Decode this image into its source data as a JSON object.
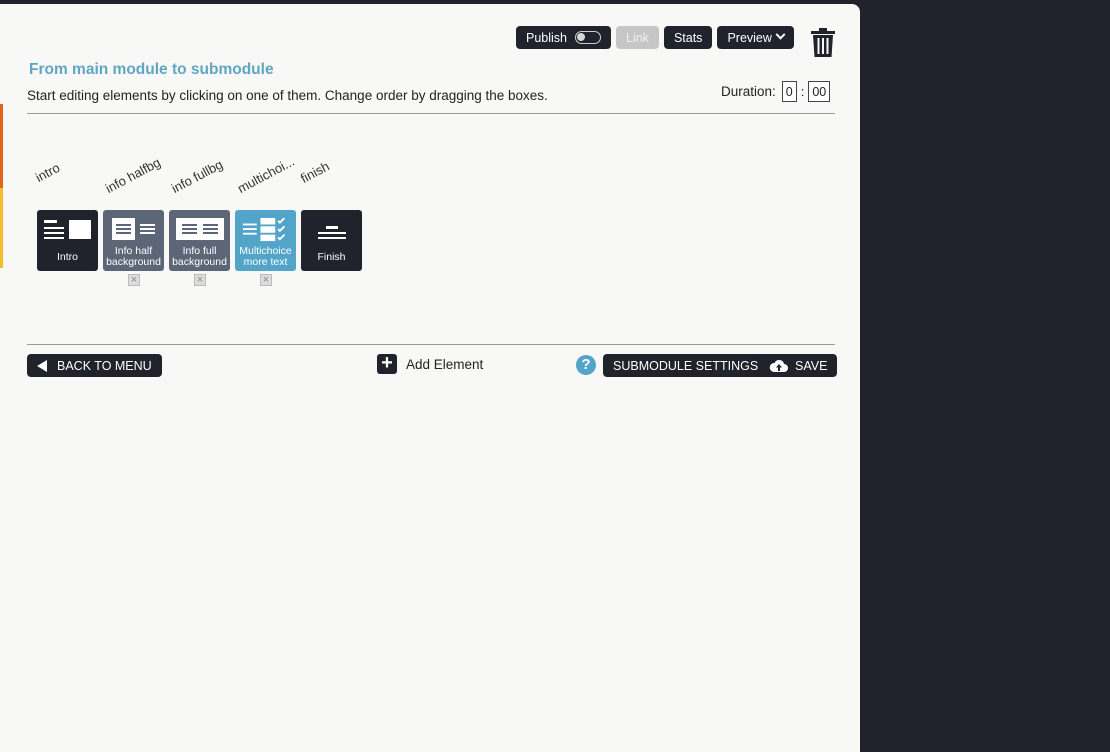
{
  "header": {
    "title": "From main module to submodule",
    "subtitle": "Start editing elements by clicking on one of them. Change order by dragging the boxes."
  },
  "toolbar": {
    "publish_label": "Publish",
    "publish_on": false,
    "link_label": "Link",
    "stats_label": "Stats",
    "preview_label": "Preview"
  },
  "duration": {
    "label": "Duration:",
    "minutes": "0",
    "separator": ":",
    "seconds": "00"
  },
  "elements": [
    {
      "label": "intro",
      "box_text": "Intro",
      "style": "dark",
      "deletable": false
    },
    {
      "label": "info halfbg",
      "box_text": "Info half background",
      "style": "gray",
      "deletable": true
    },
    {
      "label": "info fullbg",
      "box_text": "Info full background",
      "style": "gray",
      "deletable": true
    },
    {
      "label": "multichoi...",
      "box_text": "Multichoice more text",
      "style": "blue",
      "deletable": true
    },
    {
      "label": "finish",
      "box_text": "Finish",
      "style": "dark",
      "deletable": false
    }
  ],
  "footer": {
    "back_label": "BACK TO MENU",
    "add_label": "Add Element",
    "help_glyph": "?",
    "settings_label": "SUBMODULE SETTINGS",
    "save_label": "SAVE"
  },
  "colors": {
    "accent": "#52a5c8",
    "dark": "#20232b",
    "title": "#5fa6c2",
    "strip_orange": "#e0661a",
    "strip_yellow": "#f3bd2c"
  },
  "icons": [
    "toggle-icon",
    "chevron-down-icon",
    "trash-icon",
    "intro-layout-icon",
    "info-half-layout-icon",
    "info-full-layout-icon",
    "multichoice-layout-icon",
    "finish-layout-icon",
    "close-icon",
    "back-arrow-icon",
    "plus-icon",
    "help-icon",
    "cloud-upload-icon"
  ]
}
